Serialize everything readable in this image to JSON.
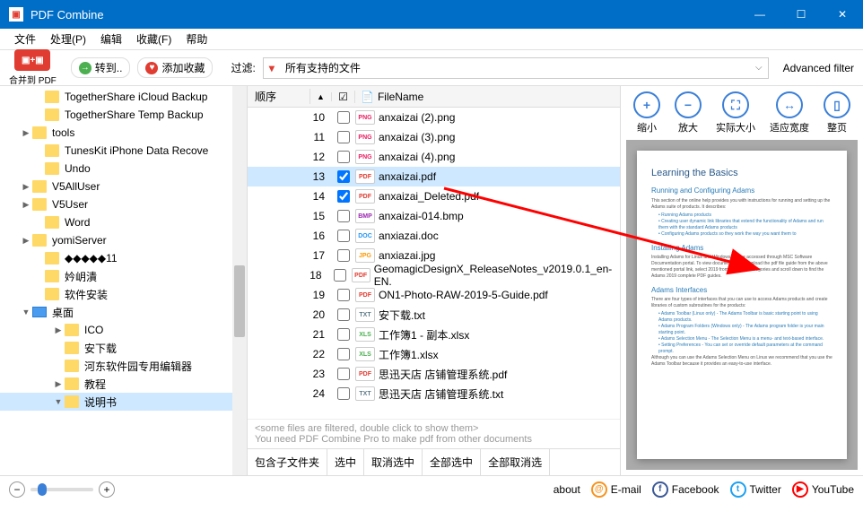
{
  "window": {
    "title": "PDF Combine"
  },
  "menu": {
    "file": "文件",
    "process": "处理(P)",
    "edit": "编辑",
    "favorites": "收藏(F)",
    "help": "帮助"
  },
  "toolbar": {
    "combine_label": "合并到 PDF",
    "goto_label": "转到..",
    "addfav_label": "添加收藏",
    "filter_label": "过滤:",
    "filter_value": "所有支持的文件",
    "advanced_filter": "Advanced filter"
  },
  "tree": {
    "items": [
      {
        "level": 1,
        "exp": "",
        "label": "TogetherShare iCloud Backup"
      },
      {
        "level": 1,
        "exp": "",
        "label": "TogetherShare Temp Backup"
      },
      {
        "level": 1,
        "exp": "▶",
        "label": "tools"
      },
      {
        "level": 1,
        "exp": "",
        "label": "TunesKit iPhone Data Recove"
      },
      {
        "level": 1,
        "exp": "",
        "label": "Undo"
      },
      {
        "level": 1,
        "exp": "▶",
        "label": "V5AllUser"
      },
      {
        "level": 1,
        "exp": "▶",
        "label": "V5User"
      },
      {
        "level": 1,
        "exp": "",
        "label": "Word"
      },
      {
        "level": 1,
        "exp": "▶",
        "label": "yomiServer"
      },
      {
        "level": 1,
        "exp": "",
        "label": "◆◆◆◆◆11"
      },
      {
        "level": 1,
        "exp": "",
        "label": "妗岄潰"
      },
      {
        "level": 1,
        "exp": "",
        "label": "软件安装"
      },
      {
        "level": 1,
        "exp": "▼",
        "label": "桌面",
        "desktop": true
      },
      {
        "level": 2,
        "exp": "▶",
        "label": "ICO"
      },
      {
        "level": 2,
        "exp": "",
        "label": "安下载"
      },
      {
        "level": 2,
        "exp": "",
        "label": "河东软件园专用编辑器"
      },
      {
        "level": 2,
        "exp": "▶",
        "label": "教程"
      },
      {
        "level": 2,
        "exp": "▼",
        "label": "说明书",
        "selected": true
      }
    ]
  },
  "files": {
    "header": {
      "order": "顺序",
      "name": "FileName"
    },
    "rows": [
      {
        "num": 10,
        "checked": false,
        "type": "png",
        "name": "anxaizai (2).png"
      },
      {
        "num": 11,
        "checked": false,
        "type": "png",
        "name": "anxaizai (3).png"
      },
      {
        "num": 12,
        "checked": false,
        "type": "png",
        "name": "anxaizai (4).png"
      },
      {
        "num": 13,
        "checked": true,
        "type": "pdf",
        "name": "anxaizai.pdf",
        "selected": true
      },
      {
        "num": 14,
        "checked": true,
        "type": "pdf",
        "name": "anxaizai_Deleted.pdf"
      },
      {
        "num": 15,
        "checked": false,
        "type": "bmp",
        "name": "anxaizai-014.bmp"
      },
      {
        "num": 16,
        "checked": false,
        "type": "doc",
        "name": "anxiazai.doc"
      },
      {
        "num": 17,
        "checked": false,
        "type": "jpg",
        "name": "anxiazai.jpg"
      },
      {
        "num": 18,
        "checked": false,
        "type": "pdf",
        "name": "GeomagicDesignX_ReleaseNotes_v2019.0.1_en-EN."
      },
      {
        "num": 19,
        "checked": false,
        "type": "pdf",
        "name": "ON1-Photo-RAW-2019-5-Guide.pdf"
      },
      {
        "num": 20,
        "checked": false,
        "type": "txt",
        "name": "安下载.txt"
      },
      {
        "num": 21,
        "checked": false,
        "type": "xls",
        "name": "工作簿1 - 副本.xlsx"
      },
      {
        "num": 22,
        "checked": false,
        "type": "xls",
        "name": "工作簿1.xlsx"
      },
      {
        "num": 23,
        "checked": false,
        "type": "pdf",
        "name": "思迅天店 店铺管理系统.pdf"
      },
      {
        "num": 24,
        "checked": false,
        "type": "txt",
        "name": "思迅天店 店铺管理系统.txt"
      }
    ],
    "hint1": "<some files are filtered, double click to show them>",
    "hint2": "You need PDF Combine Pro to make pdf from other documents",
    "actions": {
      "subfolders": "包含子文件夹",
      "select": "选中",
      "deselect": "取消选中",
      "select_all": "全部选中",
      "deselect_all": "全部取消选"
    }
  },
  "preview": {
    "tools": {
      "zoom_out": "缩小",
      "zoom_in": "放大",
      "actual": "实际大小",
      "fit_width": "适应宽度",
      "full_page": "整页"
    },
    "doc": {
      "title": "Learning the Basics",
      "section1": "Running and Configuring Adams",
      "section2": "Installing Adams",
      "section3": "Adams Interfaces"
    }
  },
  "statusbar": {
    "about": "about",
    "email": "E-mail",
    "facebook": "Facebook",
    "twitter": "Twitter",
    "youtube": "YouTube"
  }
}
